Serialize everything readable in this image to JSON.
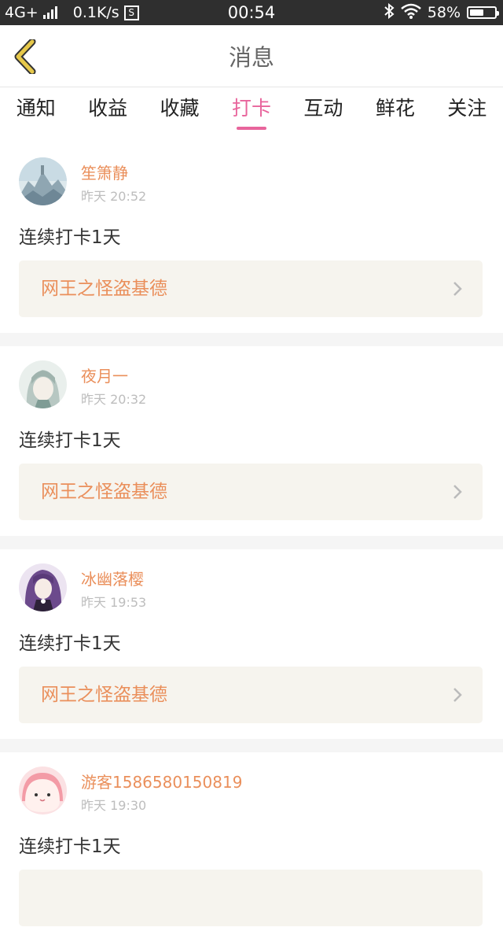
{
  "status_bar": {
    "network": "4G+",
    "speed": "0.1K/s",
    "s_badge": "S",
    "time": "00:54",
    "battery": "58%",
    "battery_level": 0.58
  },
  "header": {
    "title": "消息"
  },
  "tabs": [
    {
      "label": "通知"
    },
    {
      "label": "收益"
    },
    {
      "label": "收藏"
    },
    {
      "label": "打卡",
      "active": true
    },
    {
      "label": "互动"
    },
    {
      "label": "鲜花"
    },
    {
      "label": "关注"
    }
  ],
  "feed": [
    {
      "name": "笙箫静",
      "time": "昨天 20:52",
      "message": "连续打卡1天",
      "book": "网王之怪盗基德"
    },
    {
      "name": "夜月一",
      "time": "昨天 20:32",
      "message": "连续打卡1天",
      "book": "网王之怪盗基德"
    },
    {
      "name": "冰幽落樱",
      "time": "昨天 19:53",
      "message": "连续打卡1天",
      "book": "网王之怪盗基德"
    },
    {
      "name": "游客1586580150819",
      "time": "昨天 19:30",
      "message": "连续打卡1天",
      "book": ""
    }
  ],
  "colors": {
    "accent": "#e8659c",
    "name_text": "#ea8f5b",
    "book_bg": "#f6f4ee",
    "back_icon": "#e6c84a"
  }
}
